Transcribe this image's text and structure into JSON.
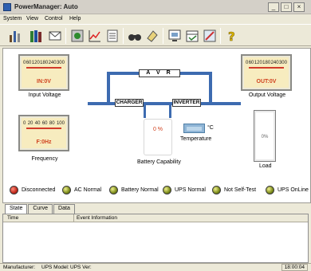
{
  "window": {
    "title": "PowerManager: Auto"
  },
  "menu": {
    "items": [
      "System",
      "View",
      "Control",
      "Help"
    ]
  },
  "toolbar": {
    "buttons": [
      {
        "icon": "tools-icon"
      },
      {
        "icon": "books-icon"
      },
      {
        "icon": "mail-icon"
      },
      {
        "icon": "power-icon"
      },
      {
        "icon": "graph-icon"
      },
      {
        "icon": "list-icon"
      },
      {
        "icon": "binoculars-icon"
      },
      {
        "icon": "erase-icon"
      },
      {
        "icon": "monitor-icon"
      },
      {
        "icon": "schedule-icon"
      },
      {
        "icon": "settings-icon"
      },
      {
        "icon": "help-icon"
      }
    ]
  },
  "meters": {
    "input_voltage": {
      "ticks": [
        "0",
        "60",
        "120",
        "180",
        "240",
        "300"
      ],
      "readout": "IN:0V",
      "label": "Input Voltage"
    },
    "output_voltage": {
      "ticks": [
        "0",
        "60",
        "120",
        "180",
        "240",
        "300"
      ],
      "readout": "OUT:0V",
      "label": "Output Voltage"
    },
    "frequency": {
      "ticks": [
        "0",
        "20",
        "40",
        "60",
        "80",
        "100"
      ],
      "readout": "F:0Hz",
      "label": "Frequency"
    }
  },
  "diagram": {
    "avr_label": "A V R",
    "charger_label": "CHARGER",
    "inverter_label": "INVERTER",
    "battery_percent": "0 %",
    "battery_label": "Battery Capability",
    "temperature_unit": "°C",
    "temperature_label": "Temperature",
    "load_percent": "0%",
    "load_label": "Load"
  },
  "status": {
    "items": [
      {
        "label": "Disconnected",
        "color": "red"
      },
      {
        "label": "AC Normal",
        "color": "green"
      },
      {
        "label": "Battery Normal",
        "color": "green"
      },
      {
        "label": "UPS Normal",
        "color": "green"
      },
      {
        "label": "Not Self-Test",
        "color": "green"
      },
      {
        "label": "UPS OnLine",
        "color": "green"
      }
    ]
  },
  "tabs": [
    "State",
    "Curve",
    "Data"
  ],
  "log": {
    "columns": [
      "Time",
      "Event Information"
    ]
  },
  "statusbar": {
    "manufacturer": "Manufacturer:",
    "model": "UPS Model:",
    "version": "UPS Ver:",
    "time": "18:00:04"
  }
}
